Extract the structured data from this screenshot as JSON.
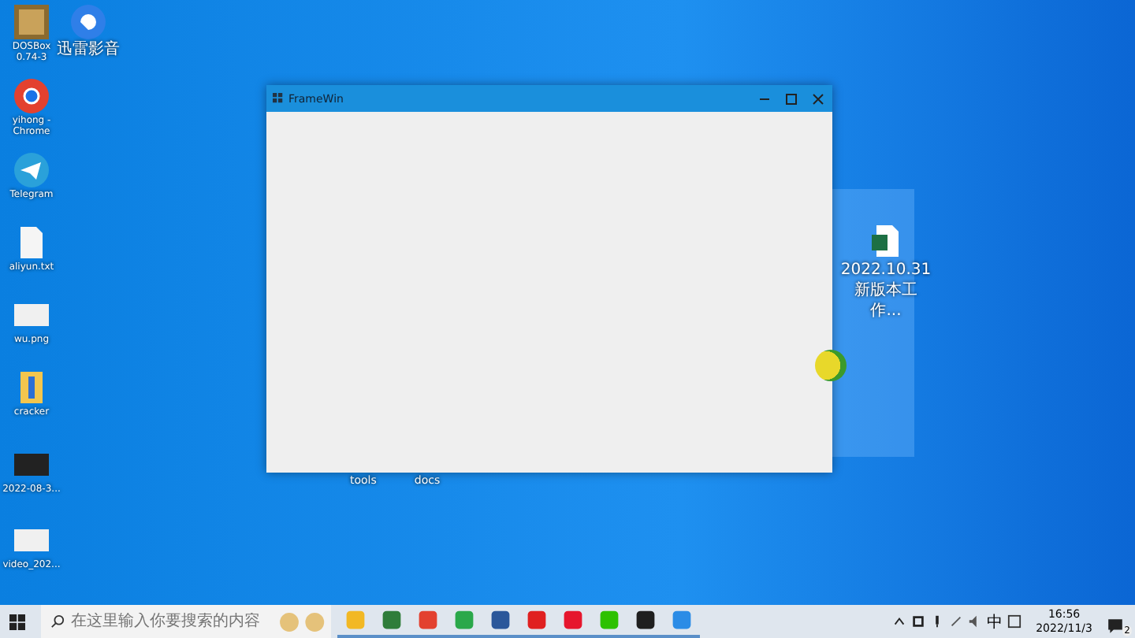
{
  "desktop_icons": [
    {
      "label": "DOSBox 0.74-3",
      "kind": "dosbox"
    },
    {
      "label": "迅雷影音",
      "kind": "player"
    },
    {
      "label": "yihong - Chrome",
      "kind": "chrome"
    },
    {
      "label": "Telegram",
      "kind": "telegram"
    },
    {
      "label": "aliyun.txt",
      "kind": "text-file"
    },
    {
      "label": "wu.png",
      "kind": "image-file"
    },
    {
      "label": "cracker",
      "kind": "zip-file"
    },
    {
      "label": "2022-08-3...",
      "kind": "video-file"
    },
    {
      "label": "video_202...",
      "kind": "image-file"
    }
  ],
  "under_window_labels": [
    "tools",
    "docs"
  ],
  "excel_file": {
    "label": "2022.10.31 新版本工作..."
  },
  "window": {
    "title": "FrameWin"
  },
  "taskbar": {
    "search": {
      "placeholder": "在这里输入你要搜索的内容"
    },
    "apps": [
      {
        "kind": "folder",
        "running": true
      },
      {
        "kind": "panda",
        "running": true
      },
      {
        "kind": "chrome",
        "running": true
      },
      {
        "kind": "chat",
        "running": true
      },
      {
        "kind": "word",
        "running": true
      },
      {
        "kind": "music",
        "running": true
      },
      {
        "kind": "weibo",
        "running": true
      },
      {
        "kind": "wechat",
        "running": true
      },
      {
        "kind": "ide",
        "running": true
      },
      {
        "kind": "widgets",
        "running": true
      }
    ],
    "tray": {
      "ime": "中",
      "time": "16:56",
      "date": "2022/11/3",
      "notifications": "2"
    }
  }
}
